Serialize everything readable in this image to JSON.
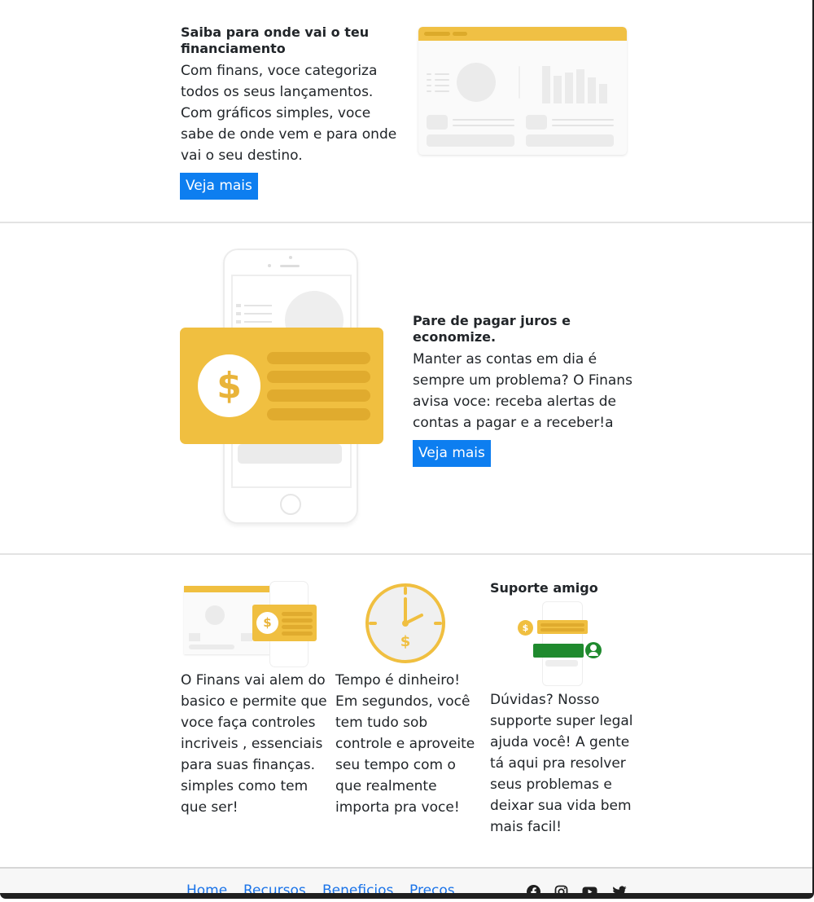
{
  "section1": {
    "title": "Saiba para onde vai o teu financiamento",
    "body": "Com finans, voce categoriza todos os seus lançamentos. Com gráficos simples, voce sabe de onde vem e para onde vai o seu destino.",
    "button": "Veja mais"
  },
  "section2": {
    "title": "Pare de pagar juros e economize.",
    "body": "Manter as contas em dia é sempre um problema? O Finans avisa voce: receba alertas de contas a pagar e a receber!a",
    "button": "Veja mais",
    "coin_symbol": "$"
  },
  "section3": {
    "col1_body": "O Finans vai alem do basico e permite que voce faça controles incriveis , essenciais para suas finanças. simples como tem que ser!",
    "col2_body": "Tempo é dinheiro! Em segundos, você tem tudo sob controle e aproveite seu tempo com o que realmente importa pra voce!",
    "col3_title": "Suporte amigo",
    "col3_body": "Dúvidas? Nosso supporte super legal ajuda você! A gente tá aqui pra resolver seus problemas e deixar sua vida bem mais facil!",
    "clock_symbol": "$",
    "mini_coin_symbol": "$"
  },
  "footer": {
    "links": [
      "Home",
      "Recursos",
      "Beneficios",
      "Precos"
    ],
    "social_icons": [
      "facebook-icon",
      "instagram-icon",
      "youtube-icon",
      "twitter-icon"
    ]
  },
  "colors": {
    "accent_blue": "#0d7ef0",
    "illustration_yellow": "#f0bf40",
    "support_green": "#1f8a2e",
    "link_blue": "#1a73e8"
  }
}
